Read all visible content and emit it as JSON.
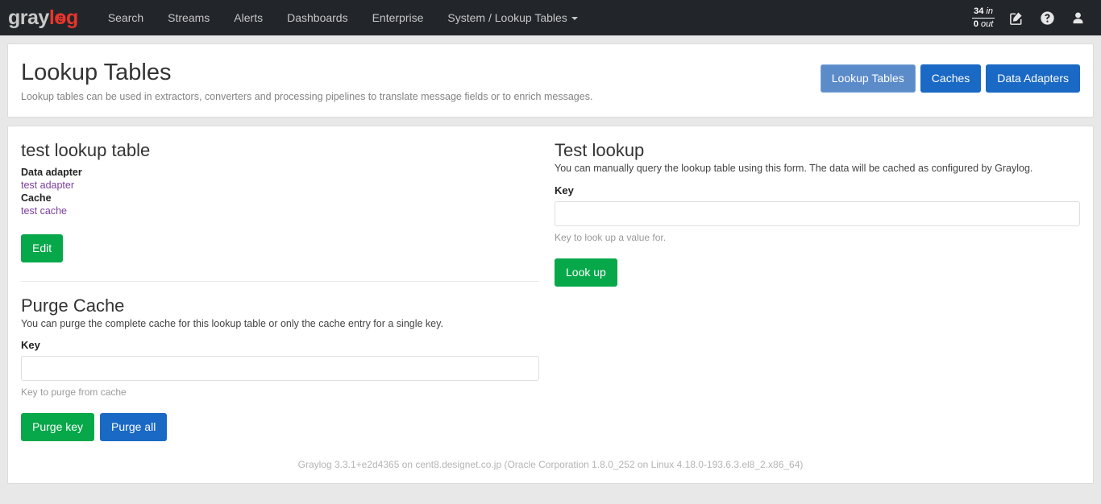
{
  "navbar": {
    "brand": {
      "part1": "gray",
      "part2": "log"
    },
    "links": [
      {
        "label": "Search",
        "caret": false
      },
      {
        "label": "Streams",
        "caret": false
      },
      {
        "label": "Alerts",
        "caret": false
      },
      {
        "label": "Dashboards",
        "caret": false
      },
      {
        "label": "Enterprise",
        "caret": false
      },
      {
        "label": "System / Lookup Tables",
        "caret": true
      }
    ],
    "throughput": {
      "in": "34",
      "in_unit": "in",
      "out": "0",
      "out_unit": "out"
    },
    "icons": [
      "edit-square-icon",
      "help-circle-icon",
      "user-icon"
    ]
  },
  "header": {
    "title": "Lookup Tables",
    "subtitle": "Lookup tables can be used in extractors, converters and processing pipelines to translate message fields or to enrich messages.",
    "actions": [
      {
        "label": "Lookup Tables",
        "state": "active"
      },
      {
        "label": "Caches",
        "state": "default"
      },
      {
        "label": "Data Adapters",
        "state": "default"
      }
    ]
  },
  "lookup_table": {
    "name": "test lookup table",
    "data_adapter_label": "Data adapter",
    "data_adapter_value": "test adapter",
    "cache_label": "Cache",
    "cache_value": "test cache",
    "edit_button": "Edit"
  },
  "purge_cache": {
    "title": "Purge Cache",
    "description": "You can purge the complete cache for this lookup table or only the cache entry for a single key.",
    "key_label": "Key",
    "key_value": "",
    "key_placeholder": "",
    "key_help": "Key to purge from cache",
    "purge_key_button": "Purge key",
    "purge_all_button": "Purge all"
  },
  "test_lookup": {
    "title": "Test lookup",
    "description": "You can manually query the lookup table using this form. The data will be cached as configured by Graylog.",
    "key_label": "Key",
    "key_value": "",
    "key_placeholder": "",
    "key_help": "Key to look up a value for.",
    "lookup_button": "Look up"
  },
  "footer": {
    "text": "Graylog 3.3.1+e2d4365 on cent8.designet.co.jp (Oracle Corporation 1.8.0_252 on Linux 4.18.0-193.6.3.el8_2.x86_64)"
  },
  "colors": {
    "navbar_bg": "#22252a",
    "brand_red": "#e8352b",
    "primary": "#1a69c4",
    "primary_active": "#5b8bc9",
    "success": "#06a84a",
    "link_visited": "#7a3f9d"
  }
}
